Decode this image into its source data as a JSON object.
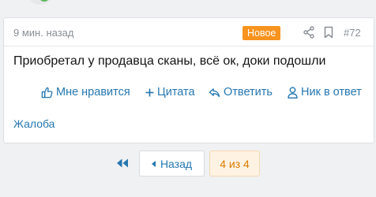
{
  "post": {
    "time": "9 мин. назад",
    "badge": "Новое",
    "number": "#72",
    "text": "Приобретал у продавца сканы, всё ок, доки подошли",
    "actions": {
      "like": "Мне нравится",
      "quote": "Цитата",
      "reply": "Ответить",
      "mention": "Ник в ответ"
    },
    "report": "Жалоба"
  },
  "pagination": {
    "prev_label": "Назад",
    "current": "4 из 4"
  },
  "colors": {
    "link": "#2577b1",
    "badge": "#f7931e",
    "current_page_bg": "#fef3e3",
    "current_page_text": "#e07b00"
  },
  "icons": {
    "share": "share-icon",
    "bookmark": "bookmark-icon",
    "like": "thumbs-up-icon",
    "quote": "plus-icon",
    "reply": "reply-icon",
    "mention": "user-icon",
    "first_page": "double-chevron-left-icon"
  }
}
